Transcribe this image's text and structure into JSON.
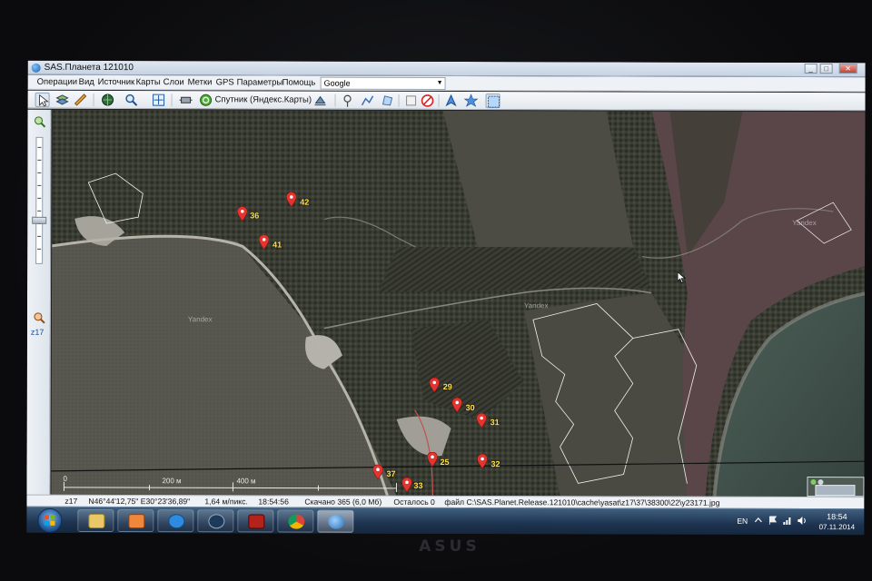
{
  "window": {
    "title": "SAS.Планета 121010",
    "controls": {
      "minimize": "_",
      "maximize": "□",
      "close": "✕"
    }
  },
  "menu": {
    "items": [
      "Операции",
      "Вид",
      "Источник",
      "Карты",
      "Слои",
      "Метки",
      "GPS",
      "Параметры",
      "Помощь"
    ],
    "map_source": "Google"
  },
  "toolbar": {
    "layer_name": "Спутник (Яндекс.Карты)",
    "icons": [
      "select-arrow-icon",
      "layers-icon",
      "ruler-icon",
      "globe-icon",
      "zoom-icon",
      "fullscreen-icon",
      "satellite-icon",
      "refresh-icon",
      "gps-icon",
      "placemark-icon",
      "path-icon",
      "polygon-icon",
      "edit-marks-icon",
      "delete-marks-icon",
      "navigation-icon",
      "star-icon",
      "selection-icon"
    ]
  },
  "zoom_panel": {
    "level": "z17"
  },
  "map": {
    "watermark": "Yandex",
    "markers": [
      "36",
      "42",
      "41",
      "29",
      "30",
      "31",
      "37",
      "25",
      "32",
      "33"
    ],
    "scale_labels": [
      "0",
      "200 м",
      "400 м"
    ]
  },
  "status": {
    "zoom": "z17",
    "coordinates": "N46°44'12,75\" E30°23'36,89\"",
    "resolution": "1,64 м/пикс.",
    "time": "18:54:56",
    "downloaded": "Скачано 365 (6,0 Мб)",
    "remaining": "Осталось 0",
    "file": "файл C:\\SAS.Planet.Release.121010\\cache\\yasat\\z17\\37\\38300\\22\\y23171.jpg"
  },
  "taskbar": {
    "apps": [
      "explorer",
      "media-player",
      "mail",
      "steam",
      "dota2",
      "chrome",
      "sas-planet"
    ],
    "language": "EN",
    "clock_time": "18:54",
    "clock_date": "07.11.2014"
  },
  "bezel": {
    "brand": "ASUS"
  },
  "colors": {
    "marker": "#e3342f",
    "marker_label": "#ffe14a",
    "boundary_lines": "#f2f2f2"
  }
}
